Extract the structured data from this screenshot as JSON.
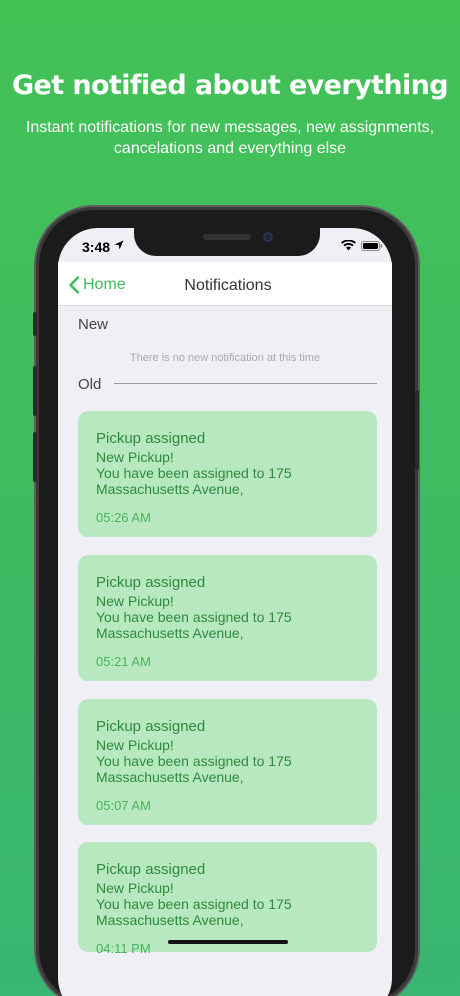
{
  "promo": {
    "headline": "Get notified about everything",
    "subline": "Instant notifications for new messages, new  assignments, cancelations and everything else"
  },
  "status_bar": {
    "time": "3:48",
    "icons": [
      "location-arrow-icon",
      "wifi-icon",
      "battery-icon"
    ]
  },
  "nav": {
    "back_label": "Home",
    "title": "Notifications"
  },
  "sections": {
    "new_label": "New",
    "empty_message": "There is no new notification at this time",
    "old_label": "Old"
  },
  "notifications": [
    {
      "title": "Pickup assigned",
      "line1": "New Pickup!",
      "line2": "You have been assigned to 175",
      "line3": "Massachusetts Avenue,",
      "time": "05:26 AM"
    },
    {
      "title": "Pickup assigned",
      "line1": "New Pickup!",
      "line2": "You have been assigned to 175",
      "line3": "Massachusetts Avenue,",
      "time": "05:21 AM"
    },
    {
      "title": "Pickup assigned",
      "line1": "New Pickup!",
      "line2": "You have been assigned to 175",
      "line3": "Massachusetts Avenue,",
      "time": "05:07 AM"
    },
    {
      "title": "Pickup assigned",
      "line1": "New Pickup!",
      "line2": "You have been assigned to 175",
      "line3": "Massachusetts Avenue,",
      "time": "04:11 PM"
    }
  ],
  "colors": {
    "accent": "#3dbb57",
    "card_bg": "#b8e8bf",
    "card_text": "#2e8a3e",
    "background": "#44c256"
  }
}
